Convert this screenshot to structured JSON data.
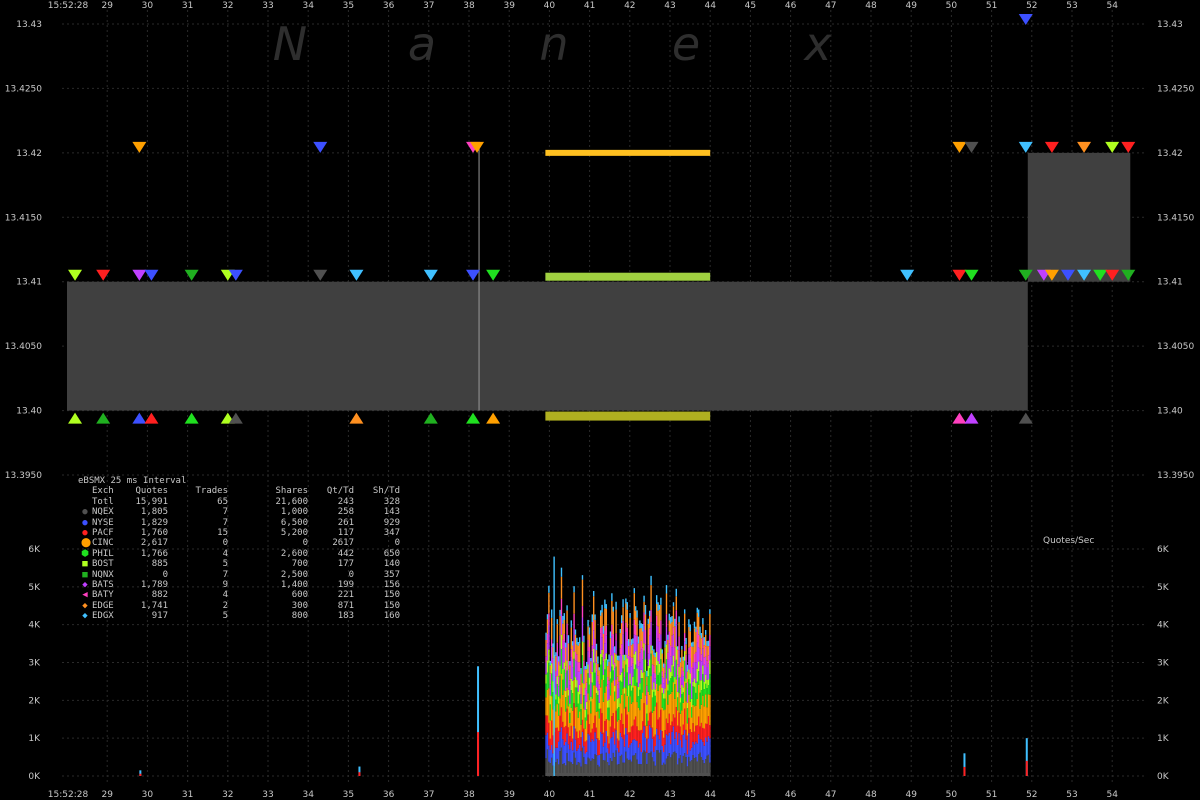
{
  "chart_data": {
    "type": "line",
    "watermark": [
      "N",
      "a",
      "n",
      "e",
      "x"
    ],
    "time_axis": {
      "start_label": "15:52:28",
      "tick_labels": [
        "29",
        "30",
        "31",
        "32",
        "33",
        "34",
        "35",
        "36",
        "37",
        "38",
        "39",
        "40",
        "41",
        "42",
        "43",
        "44",
        "45",
        "46",
        "47",
        "48",
        "49",
        "50",
        "51",
        "52",
        "53",
        "54"
      ]
    },
    "price_axis": {
      "labels": [
        "13.43",
        "13.4250",
        "13.42",
        "13.4150",
        "13.41",
        "13.4050",
        "13.40",
        "13.3950"
      ],
      "values": [
        13.43,
        13.425,
        13.42,
        13.415,
        13.41,
        13.405,
        13.4,
        13.395
      ],
      "range": [
        13.395,
        13.43
      ]
    },
    "nbbo": [
      {
        "start": 28.0,
        "end": 38.25,
        "bid": 13.4,
        "ask": 13.41
      },
      {
        "start": 38.25,
        "end": 51.9,
        "bid": 13.4,
        "ask": 13.41
      },
      {
        "start": 51.9,
        "end": 54.45,
        "bid": 13.41,
        "ask": 13.42
      }
    ],
    "rate_axis": {
      "title": "Quotes/Sec",
      "labels": [
        "6K",
        "5K",
        "4K",
        "3K",
        "2K",
        "1K",
        "0K"
      ],
      "values": [
        6000,
        5000,
        4000,
        3000,
        2000,
        1000,
        0
      ],
      "range": [
        0,
        6000
      ]
    },
    "burst": {
      "start": 39.9,
      "end": 44.0,
      "avg_quotes_per_sec": 4400,
      "peak_quotes_per_sec": 5800
    },
    "spikes": [
      {
        "t": 38.2,
        "quotes_per_sec": 2900
      },
      {
        "t": 51.85,
        "quotes_per_sec": 1000
      },
      {
        "t": 50.3,
        "quotes_per_sec": 600
      },
      {
        "t": 29.8,
        "quotes_per_sec": 150
      },
      {
        "t": 35.25,
        "quotes_per_sec": 250
      }
    ],
    "stats": {
      "title": "eBSMX 25 ms Interval",
      "headers": [
        "Exch",
        "Quotes",
        "Trades",
        "Shares",
        "Qt/Td",
        "Sh/Td"
      ],
      "total": [
        "Totl",
        "15,991",
        "65",
        "21,600",
        "243",
        "328"
      ],
      "rows": [
        {
          "exch": "NQEX",
          "quotes": "1,805",
          "trades": "7",
          "shares": "1,000",
          "qt_td": "258",
          "sh_td": "143",
          "color": "#505050",
          "marker": "●"
        },
        {
          "exch": "NYSE",
          "quotes": "1,829",
          "trades": "7",
          "shares": "6,500",
          "qt_td": "261",
          "sh_td": "929",
          "color": "#3c50ff",
          "marker": "●"
        },
        {
          "exch": "PACF",
          "quotes": "1,760",
          "trades": "15",
          "shares": "5,200",
          "qt_td": "117",
          "sh_td": "347",
          "color": "#ff2020",
          "marker": "●"
        },
        {
          "exch": "CINC",
          "quotes": "2,617",
          "trades": "0",
          "shares": "0",
          "qt_td": "2617",
          "sh_td": "0",
          "color": "#ffa000",
          "marker": "⬤"
        },
        {
          "exch": "PHIL",
          "quotes": "1,766",
          "trades": "4",
          "shares": "2,600",
          "qt_td": "442",
          "sh_td": "650",
          "color": "#20e020",
          "marker": "⬢"
        },
        {
          "exch": "BOST",
          "quotes": "885",
          "trades": "5",
          "shares": "700",
          "qt_td": "177",
          "sh_td": "140",
          "color": "#b0ff20",
          "marker": "■"
        },
        {
          "exch": "NQNX",
          "quotes": "0",
          "trades": "7",
          "shares": "2,500",
          "qt_td": "0",
          "sh_td": "357",
          "color": "#20b020",
          "marker": "■"
        },
        {
          "exch": "BATS",
          "quotes": "1,789",
          "trades": "9",
          "shares": "1,400",
          "qt_td": "199",
          "sh_td": "156",
          "color": "#c040ff",
          "marker": "◆"
        },
        {
          "exch": "BATY",
          "quotes": "882",
          "trades": "4",
          "shares": "600",
          "qt_td": "221",
          "sh_td": "150",
          "color": "#ff40c0",
          "marker": "◀"
        },
        {
          "exch": "EDGE",
          "quotes": "1,741",
          "trades": "2",
          "shares": "300",
          "qt_td": "871",
          "sh_td": "150",
          "color": "#ff9020",
          "marker": "◆"
        },
        {
          "exch": "EDGX",
          "quotes": "917",
          "trades": "5",
          "shares": "800",
          "qt_td": "183",
          "sh_td": "160",
          "color": "#40c0ff",
          "marker": "◆"
        }
      ]
    },
    "colors": {
      "background": "#000000",
      "grid": "#2a2a2a",
      "nbbo_fill": "#404040",
      "text": "#c8c8c8"
    }
  }
}
